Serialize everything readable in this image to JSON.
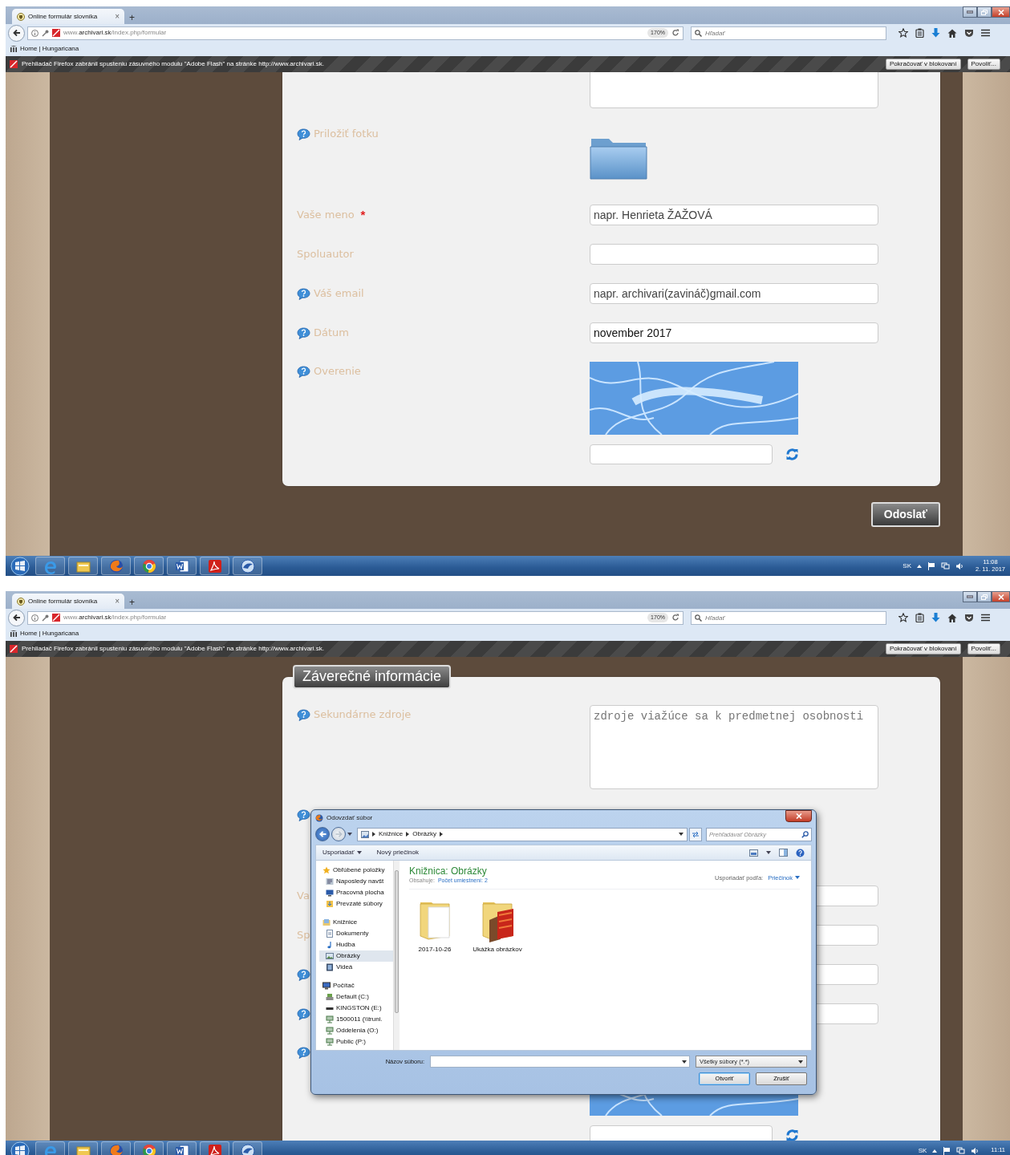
{
  "screens": [
    {
      "browser": {
        "tab_title": "Online formulár slovníka",
        "tab_close": "×",
        "new_tab": "+",
        "url": "www.**archivari.sk**/index.php/formular",
        "zoom": "170%",
        "search_placeholder": "Hľadať",
        "bookmark": "Home | Hungaricana",
        "notification": "Prehliadač Firefox zabránil spusteniu zásuvného modulu \"Adobe Flash\" na stránke http://www.archivari.sk.",
        "notification_buttons": [
          "Pokračovať v blokovaní",
          "Povoliť..."
        ]
      },
      "form": {
        "scrolled": true,
        "rows": [
          {
            "kind": "textarea"
          },
          {
            "kind": "file",
            "label": "Priložiť fotku",
            "help": true
          },
          {
            "kind": "input",
            "label": "Vaše meno",
            "help": false,
            "required_mark": "*",
            "placeholder": "napr. Henrieta ŽAŽOVÁ"
          },
          {
            "kind": "input",
            "label": "Spoluautor",
            "help": false
          },
          {
            "kind": "input",
            "label": "Váš email",
            "help": true,
            "placeholder": "napr. archivari(zavináč)gmail.com"
          },
          {
            "kind": "input",
            "label": "Dátum",
            "help": true,
            "value": "november 2017"
          },
          {
            "kind": "captcha",
            "label": "Overenie",
            "help": true
          }
        ],
        "submit": "Odoslať"
      },
      "taskbar": {
        "language": "SK",
        "time": "11:08",
        "date": "2. 11. 2017"
      }
    },
    {
      "browser": {
        "tab_title": "Online formulár slovníka",
        "tab_close": "×",
        "new_tab": "+",
        "url": "www.**archivari.sk**/index.php/formular",
        "zoom": "170%",
        "search_placeholder": "Hľadať",
        "bookmark": "Home | Hungaricana",
        "notification": "Prehliadač Firefox zabránil spusteniu zásuvného modulu \"Adobe Flash\" na stránke http://www.archivari.sk.",
        "notification_buttons": [
          "Pokračovať v blokovaní",
          "Povoliť..."
        ]
      },
      "form": {
        "scrolled": false,
        "section_title": "Záverečné informácie",
        "rows": [
          {
            "kind": "textarea",
            "label": "Sekundárne zdroje",
            "help": true,
            "placeholder": "zdroje viažúce sa k predmetnej osobnosti"
          },
          {
            "kind": "file",
            "help": true
          },
          {
            "kind": "input",
            "label": "Va",
            "help": false
          },
          {
            "kind": "input",
            "label": "Sp",
            "help": false
          },
          {
            "kind": "input",
            "help": true
          },
          {
            "kind": "input",
            "help": true
          },
          {
            "kind": "captcha",
            "help": true
          }
        ]
      },
      "dialog": {
        "title": "Odovzdať súbor",
        "breadcrumb": [
          "Knižnice",
          "Obrázky"
        ],
        "search_placeholder": "Prehľadávať Obrázky",
        "toolbar": [
          {
            "label": "Usporiadať",
            "menu": true
          },
          {
            "label": "Nový priečinok",
            "menu": false
          }
        ],
        "nav": [
          {
            "label": "Obľúbené položky",
            "kind": "favorites",
            "selected": false,
            "children": [
              {
                "label": "Naposledy navšt",
                "kind": "recent",
                "selected": false
              },
              {
                "label": "Pracovná plocha",
                "kind": "desktop",
                "selected": false
              },
              {
                "label": "Prevzaté súbory",
                "kind": "downloads",
                "selected": false
              }
            ]
          },
          {
            "label": "Knižnice",
            "kind": "libraries",
            "selected": false,
            "children": [
              {
                "label": "Dokumenty",
                "kind": "documents",
                "selected": false
              },
              {
                "label": "Hudba",
                "kind": "music",
                "selected": false
              },
              {
                "label": "Obrázky",
                "kind": "pictures",
                "selected": true
              },
              {
                "label": "Videá",
                "kind": "videos",
                "selected": false
              }
            ]
          },
          {
            "label": "Počítač",
            "kind": "computer",
            "selected": false,
            "children": [
              {
                "label": "Default (C:)",
                "kind": "drive",
                "selected": false
              },
              {
                "label": "KINGSTON (E:)",
                "kind": "usb",
                "selected": false
              },
              {
                "label": "1500011 (\\\\truni.",
                "kind": "network",
                "selected": false
              },
              {
                "label": "Oddelenia (O:)",
                "kind": "network",
                "selected": false
              },
              {
                "label": "Public (P:)",
                "kind": "network",
                "selected": false
              }
            ]
          }
        ],
        "library_title": "Knižnica: Obrázky",
        "includes_label": "Obsahuje:",
        "includes_link": "Počet umiestnení: 2",
        "arrange_label": "Usporiadať podľa:",
        "arrange_value": "Priečinok",
        "items": [
          {
            "name": "2017-10-26",
            "kind": "folder"
          },
          {
            "name": "Ukážka obrázkov",
            "kind": "pictures"
          }
        ],
        "filename_label": "Názov súboru:",
        "filter": "Všetky súbory (*.*)",
        "buttons": [
          {
            "label": "Otvoriť",
            "default": true
          },
          {
            "label": "Zrušiť",
            "default": false
          }
        ]
      },
      "taskbar": {
        "language": "SK",
        "time": "11:11"
      }
    }
  ]
}
